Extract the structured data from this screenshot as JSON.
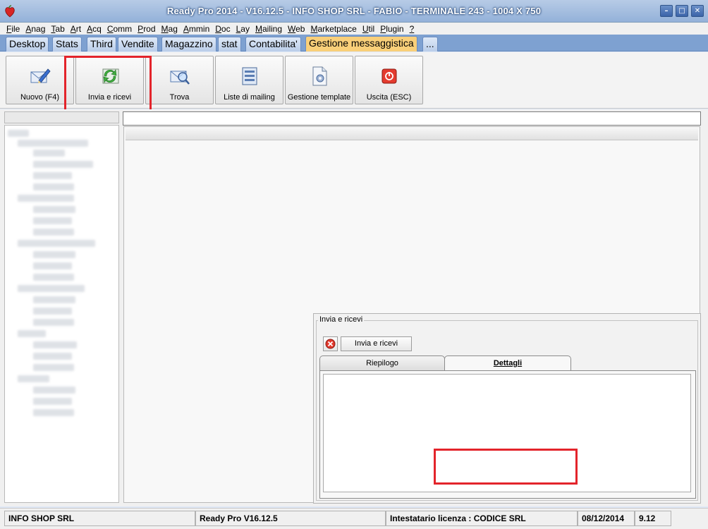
{
  "window": {
    "title": "Ready Pro 2014 - V16.12.5 - INFO SHOP SRL - FABIO - TERMINALE 243 - 1004 X 750",
    "controls": {
      "minimize": "–",
      "maximize": "□",
      "close": "✕"
    }
  },
  "menu": {
    "items": [
      {
        "u": "F",
        "rest": "ile"
      },
      {
        "u": "A",
        "rest": "nag"
      },
      {
        "u": "T",
        "rest": "ab"
      },
      {
        "u": "A",
        "rest": "rt"
      },
      {
        "u": "A",
        "rest": "cq"
      },
      {
        "u": "C",
        "rest": "omm"
      },
      {
        "u": "P",
        "rest": "rod"
      },
      {
        "u": "M",
        "rest": "ag"
      },
      {
        "u": "A",
        "rest": "mmin"
      },
      {
        "u": "D",
        "rest": "oc"
      },
      {
        "u": "L",
        "rest": "ay"
      },
      {
        "u": "M",
        "rest": "ailing"
      },
      {
        "u": "W",
        "rest": "eb"
      },
      {
        "u": "M",
        "rest": "arketplace"
      },
      {
        "u": "U",
        "rest": "til"
      },
      {
        "u": "P",
        "rest": "lugin"
      },
      {
        "u": "?",
        "rest": ""
      }
    ]
  },
  "tabs": [
    "Desktop",
    "Stats",
    "Third",
    "Vendite",
    "Magazzino",
    "stat",
    "Contabilita'",
    "Gestione messaggistica",
    "..."
  ],
  "active_tab": "Gestione messaggistica",
  "toolbar": {
    "buttons": [
      {
        "label": "Nuovo (F4)",
        "icon": "new-message-icon"
      },
      {
        "label": "Invia e ricevi",
        "icon": "send-receive-icon"
      },
      {
        "label": "Trova",
        "icon": "find-icon"
      },
      {
        "label": "Liste di mailing",
        "icon": "mailing-list-icon"
      },
      {
        "label": "Gestione template",
        "icon": "template-icon"
      },
      {
        "label": "Uscita (ESC)",
        "icon": "exit-icon"
      }
    ]
  },
  "dialog": {
    "group_title": "Invia e ricevi",
    "send_button": "Invia e ricevi",
    "tabs": [
      "Riepilogo",
      "Dettagli"
    ],
    "active_tab": "Dettagli"
  },
  "status": {
    "company": "INFO SHOP SRL",
    "version": "Ready Pro V16.12.5",
    "license": "Intestatario licenza : CODICE SRL",
    "date": "08/12/2014",
    "time": "9.12"
  },
  "colors": {
    "active_tab": "#f9cf79",
    "highlight": "#e3242b",
    "tab_strip": "#7ea1d1"
  }
}
